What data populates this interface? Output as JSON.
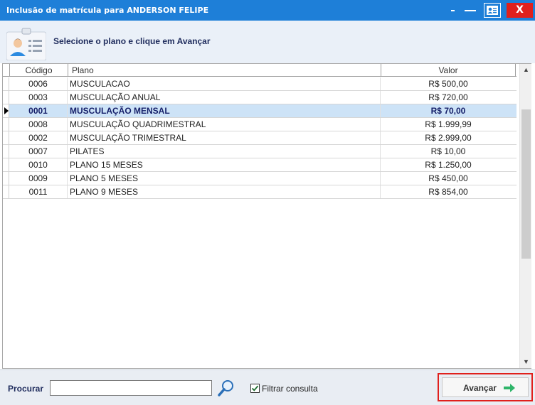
{
  "window": {
    "title": "Inclusão de matrícula para ANDERSON FELIPE",
    "close_label": "X"
  },
  "header": {
    "instruction": "Selecione o plano e clique em Avançar"
  },
  "table": {
    "columns": [
      "Código",
      "Plano",
      "Valor"
    ],
    "rows": [
      {
        "codigo": "0006",
        "plano": "MUSCULACAO",
        "valor": "R$ 500,00"
      },
      {
        "codigo": "0003",
        "plano": "MUSCULAÇÃO ANUAL",
        "valor": "R$ 720,00"
      },
      {
        "codigo": "0001",
        "plano": "MUSCULAÇÃO MENSAL",
        "valor": "R$ 70,00"
      },
      {
        "codigo": "0008",
        "plano": "MUSCULAÇÃO QUADRIMESTRAL",
        "valor": "R$ 1.999,99"
      },
      {
        "codigo": "0002",
        "plano": "MUSCULAÇÃO TRIMESTRAL",
        "valor": "R$ 2.999,00"
      },
      {
        "codigo": "0007",
        "plano": "PILATES",
        "valor": "R$ 10,00"
      },
      {
        "codigo": "0010",
        "plano": "PLANO 15 MESES",
        "valor": "R$ 1.250,00"
      },
      {
        "codigo": "0009",
        "plano": "PLANO 5 MESES",
        "valor": "R$ 450,00"
      },
      {
        "codigo": "0011",
        "plano": "PLANO 9 MESES",
        "valor": "R$ 854,00"
      }
    ],
    "selected_index": 2
  },
  "footer": {
    "search_label": "Procurar",
    "search_value": "",
    "filter_label": "Filtrar consulta",
    "filter_checked": true,
    "next_label": "Avançar"
  },
  "icons": {
    "header": "user-profile-icon",
    "search": "magnifier-icon",
    "next": "arrow-right-icon",
    "window_info": "id-card-icon"
  },
  "colors": {
    "titlebar": "#1e7fd8",
    "close": "#e0201c",
    "selected_row": "#cde3f7",
    "highlight_border": "#e0201c",
    "next_arrow": "#2fb56a"
  }
}
